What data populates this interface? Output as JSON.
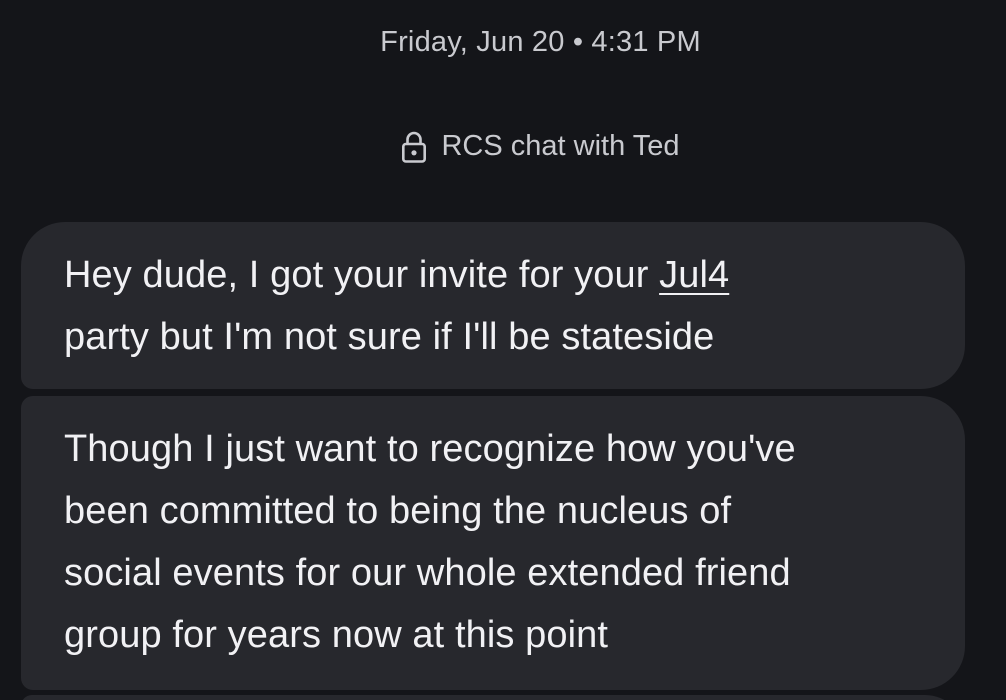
{
  "conversation": {
    "timestamp": "Friday, Jun 20 • 4:31 PM",
    "encryption_banner": "RCS chat with Ted",
    "lock_icon": "lock-icon"
  },
  "messages": [
    {
      "lines": [
        {
          "before": "Hey dude, I got your invite for your ",
          "link": "Jul4"
        },
        {
          "text": "party but I'm not sure if I'll be stateside"
        }
      ]
    },
    {
      "lines": [
        "Though I just want to recognize how you've",
        "been committed to being the nucleus of",
        "social events for our whole extended friend",
        "group for years now at this point"
      ]
    }
  ],
  "colors": {
    "background": "#141519",
    "bubble": "#27282d",
    "text": "#f1f1f4",
    "meta_text": "#c9cacf"
  }
}
